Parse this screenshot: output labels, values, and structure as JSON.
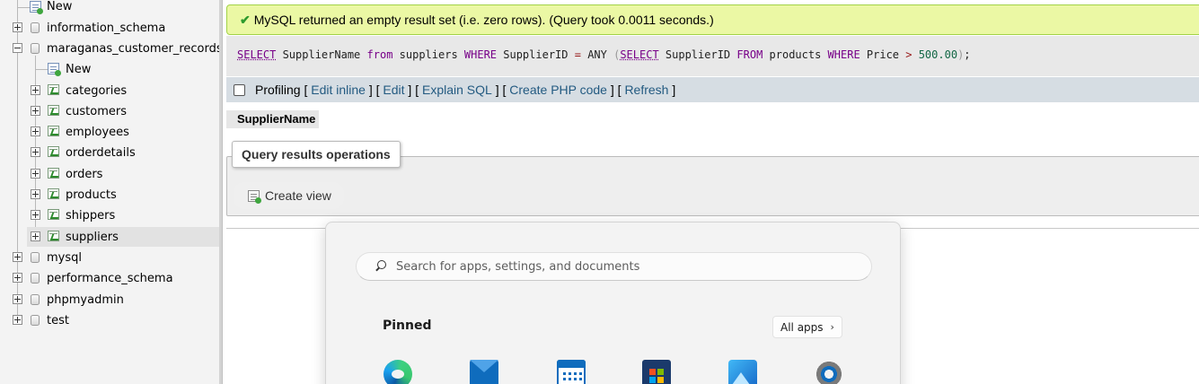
{
  "sidebar": {
    "top_new_label": "New",
    "databases": [
      {
        "name": "information_schema"
      },
      {
        "name": "maraganas_customer_records"
      },
      {
        "name": "mysql"
      },
      {
        "name": "performance_schema"
      },
      {
        "name": "phpmyadmin"
      },
      {
        "name": "test"
      }
    ],
    "expanded_db": {
      "new_label": "New",
      "tables": [
        "categories",
        "customers",
        "employees",
        "orderdetails",
        "orders",
        "products",
        "shippers",
        "suppliers"
      ],
      "selected_table": "suppliers"
    }
  },
  "message": {
    "text": "MySQL returned an empty result set (i.e. zero rows). (Query took 0.0011 seconds.)",
    "status_color": "#ebf8a4"
  },
  "sql": {
    "tokens": {
      "select1": "SELECT",
      "t1": " SupplierName ",
      "from1": "from",
      "t2": " suppliers ",
      "where1": "WHERE",
      "t3": " SupplierID ",
      "eq": "=",
      "t4": " ANY ",
      "lparen": "(",
      "select2": "SELECT",
      "t5": " SupplierID ",
      "from2": "FROM",
      "t6": " products ",
      "where2": "WHERE",
      "t7": " Price ",
      "gt": ">",
      "num": " 500.00",
      "rparen": ")",
      "semi": ";"
    }
  },
  "toolbar": {
    "profiling_label": "Profiling",
    "links": [
      "Edit inline",
      "Edit",
      "Explain SQL",
      "Create PHP code",
      "Refresh"
    ]
  },
  "results": {
    "column_header": "SupplierName"
  },
  "operations": {
    "legend": "Query results operations",
    "create_view_label": "Create view"
  },
  "start_menu": {
    "search_placeholder": "Search for apps, settings, and documents",
    "pinned_label": "Pinned",
    "all_apps_label": "All apps",
    "apps": [
      "edge-icon",
      "mail-icon",
      "calendar-icon",
      "store-icon",
      "photos-icon",
      "settings-icon"
    ]
  }
}
